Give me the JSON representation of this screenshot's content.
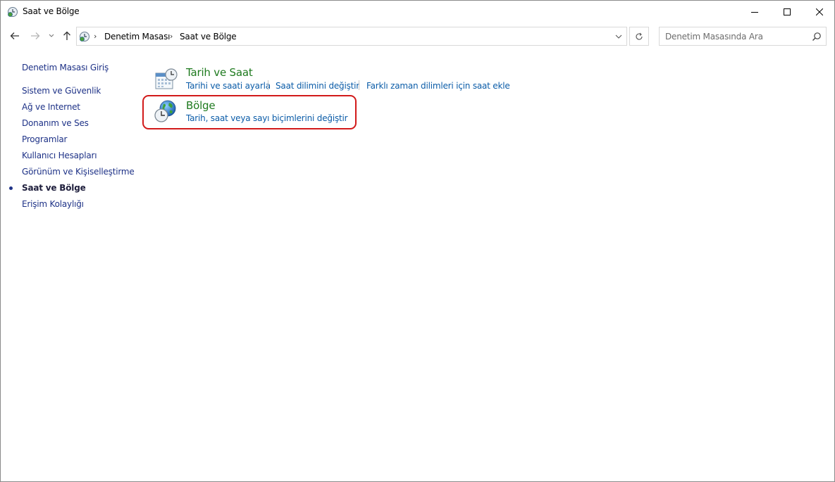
{
  "window": {
    "title": "Saat ve Bölge"
  },
  "navigation": {
    "breadcrumbs": [
      "Denetim Masası",
      "Saat ve Bölge"
    ],
    "search_placeholder": "Denetim Masasında Ara"
  },
  "sidebar": {
    "home_label": "Denetim Masası Giriş",
    "items": [
      {
        "label": "Sistem ve Güvenlik",
        "current": false
      },
      {
        "label": "Ağ ve Internet",
        "current": false
      },
      {
        "label": "Donanım ve Ses",
        "current": false
      },
      {
        "label": "Programlar",
        "current": false
      },
      {
        "label": "Kullanıcı Hesapları",
        "current": false
      },
      {
        "label": "Görünüm ve Kişiselleştirme",
        "current": false
      },
      {
        "label": "Saat ve Bölge",
        "current": true
      },
      {
        "label": "Erişim Kolaylığı",
        "current": false
      }
    ]
  },
  "categories": [
    {
      "title": "Tarih ve Saat",
      "icon": "calendar-clock-icon",
      "links": [
        "Tarihi ve saati ayarla",
        "Saat dilimini değiştir",
        "Farklı zaman dilimleri için saat ekle"
      ]
    },
    {
      "title": "Bölge",
      "icon": "globe-clock-icon",
      "links": [
        "Tarih, saat veya sayı biçimlerini değiştir"
      ],
      "highlighted": true
    }
  ],
  "colors": {
    "category_title": "#1e7a1e",
    "link": "#0b5ca8",
    "sidebar_link": "#1e3287",
    "highlight_border": "#d21a1a"
  }
}
